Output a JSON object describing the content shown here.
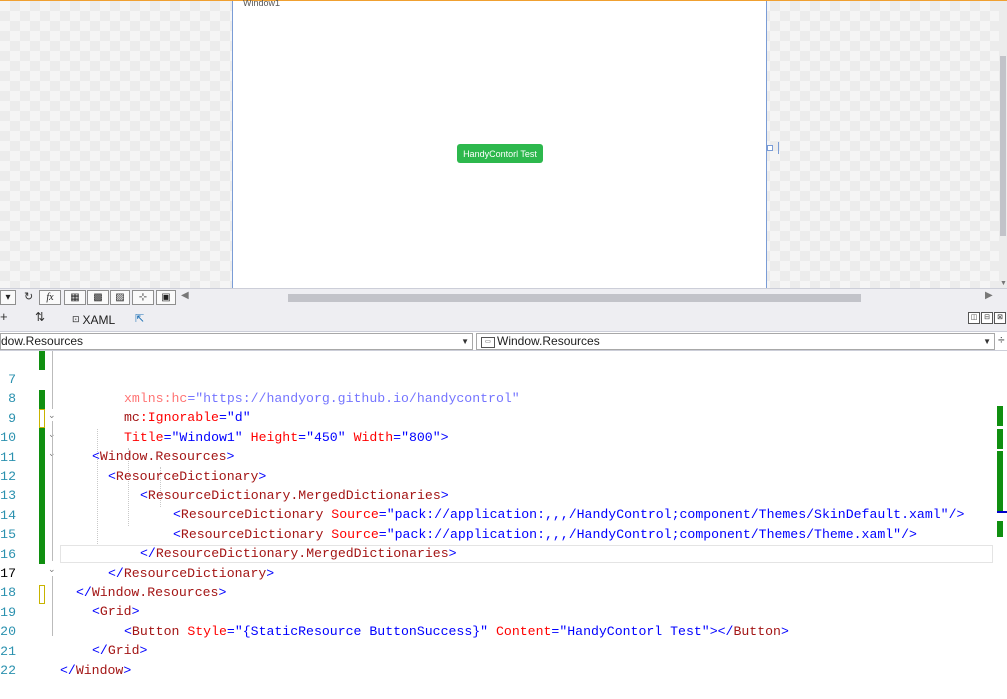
{
  "designer": {
    "window_title": "Window1",
    "button_label": "HandyContorl Test",
    "button_color": "#2db84d"
  },
  "toolbar": {
    "fx_label": "fx"
  },
  "tabs": {
    "xaml_label": "XAML"
  },
  "nav": {
    "left_value": "dow.Resources",
    "right_value": "Window.Resources"
  },
  "colors": {
    "tag": "#a31515",
    "attribute": "#ff0000",
    "value": "#0000ff",
    "line_number": "#2b91af",
    "change_bar": "#108f10"
  },
  "code": {
    "line_numbers": [
      "7",
      "8",
      "9",
      "10",
      "11",
      "12",
      "13",
      "14",
      "15",
      "16",
      "17",
      "18",
      "19",
      "20",
      "21",
      "22"
    ],
    "l7": {
      "attr": "xmlns:hc",
      "eq": "=",
      "val": "\"https://handyorg.github.io/handycontrol\""
    },
    "l8": {
      "prefix": "mc",
      "attr": ":Ignorable",
      "eq": "=",
      "val": "\"d\""
    },
    "l9": {
      "a1": "Title",
      "v1": "\"Window1\"",
      "a2": "Height",
      "v2": "\"450\"",
      "a3": "Width",
      "v3": "\"800\"",
      "close": ">"
    },
    "l10": {
      "open": "<",
      "tag": "Window.Resources",
      "close": ">"
    },
    "l11": {
      "open": "<",
      "tag": "ResourceDictionary",
      "close": ">"
    },
    "l12": {
      "open": "<",
      "tag": "ResourceDictionary.MergedDictionaries",
      "close": ">"
    },
    "l13": {
      "open": "<",
      "tag": "ResourceDictionary",
      "attr": "Source",
      "eq": "=",
      "val": "\"pack://application:,,,/HandyControl;component/Themes/SkinDefault.xaml\"",
      "close": "/>"
    },
    "l14": {
      "open": "<",
      "tag": "ResourceDictionary",
      "attr": "Source",
      "eq": "=",
      "val": "\"pack://application:,,,/HandyControl;component/Themes/Theme.xaml\"",
      "close": "/>"
    },
    "l15": {
      "open": "</",
      "tag": "ResourceDictionary.MergedDictionaries",
      "close": ">"
    },
    "l16": {
      "open": "</",
      "tag": "ResourceDictionary",
      "close": ">"
    },
    "l17": {
      "open": "</",
      "tag": "Window.Resources",
      "close": ">"
    },
    "l18": {
      "open": "<",
      "tag": "Grid",
      "close": ">"
    },
    "l19": {
      "open": "<",
      "tag": "Button",
      "a1": "Style",
      "v1": "\"{StaticResource ButtonSuccess}\"",
      "a2": "Content",
      "v2": "\"HandyContorl Test\"",
      "close1": "></",
      "tag2": "Button",
      "close2": ">"
    },
    "l20": {
      "open": "</",
      "tag": "Grid",
      "close": ">"
    },
    "l21": {
      "open": "</",
      "tag": "Window",
      "close": ">"
    }
  }
}
